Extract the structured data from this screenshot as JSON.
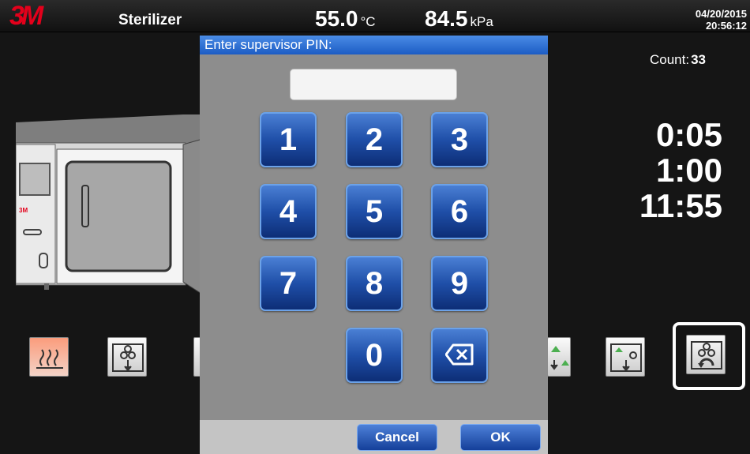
{
  "status": {
    "logo": "3M",
    "title": "Sterilizer",
    "temperature": "55.0",
    "temperature_unit": "°C",
    "pressure": "84.5",
    "pressure_unit": "kPa",
    "date": "04/20/2015",
    "time": "20:56:12"
  },
  "main": {
    "count_label": "Count:",
    "count_value": "33",
    "times": [
      "0:05",
      "1:00",
      "11:55"
    ],
    "colon_stub": ":",
    "machine_brand": "3M"
  },
  "icons": [
    "heat-icon",
    "load-down-icon",
    "partial-icon",
    "partial-icon",
    "load-up-down-icon",
    "cycle-rotate-icon"
  ],
  "modal": {
    "title": "Enter supervisor PIN:",
    "pin_value": "",
    "keys": [
      "1",
      "2",
      "3",
      "4",
      "5",
      "6",
      "7",
      "8",
      "9",
      "0"
    ],
    "backspace_icon": "backspace-icon",
    "cancel_label": "Cancel",
    "ok_label": "OK"
  },
  "colors": {
    "brand_red": "#e3001b",
    "key_blue": "#1f4fa8",
    "modal_header_blue": "#1c5cc4",
    "modal_bg": "#8d8d8d"
  }
}
